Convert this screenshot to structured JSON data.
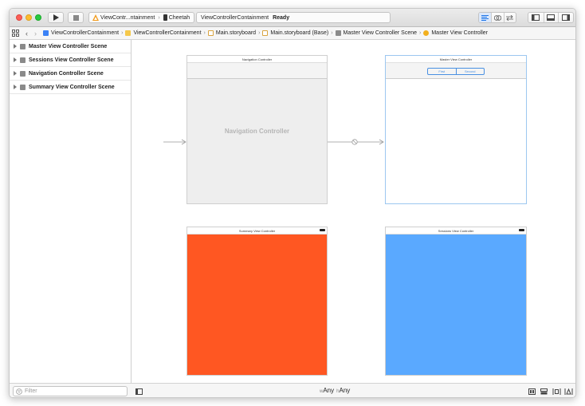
{
  "toolbar": {
    "scheme_name": "ViewContr...ntainment",
    "device_name": "Cheetah",
    "activity_project": "ViewControllerContainment",
    "activity_status": "Ready"
  },
  "jumpbar": {
    "items": [
      "ViewControllerContainment",
      "ViewControllerContainment",
      "Main.storyboard",
      "Main.storyboard (Base)",
      "Master View Controller Scene",
      "Master View Controller"
    ]
  },
  "outline": {
    "scenes": [
      "Master View Controller Scene",
      "Sessions View Controller Scene",
      "Navigation Controller Scene",
      "Summary View Controller Scene"
    ]
  },
  "canvas": {
    "nav_controller_title": "Navigation Controller",
    "nav_controller_label": "Navigation Controller",
    "master_title": "Master View Controller",
    "segment_first": "First",
    "segment_second": "Second",
    "summary_title": "Summary View Controller",
    "sessions_title": "Sessions View Controller"
  },
  "bottom": {
    "filter_placeholder": "Filter",
    "size_class_w_prefix": "w",
    "size_class_w": "Any",
    "size_class_h_prefix": "h",
    "size_class_h": "Any"
  },
  "colors": {
    "summary_bg": "#FF5722",
    "sessions_bg": "#5AA9FF",
    "nav_bg": "#EEEEEE",
    "selection_border": "#9CC7F0",
    "navigator_selected": "#1A73E8"
  }
}
